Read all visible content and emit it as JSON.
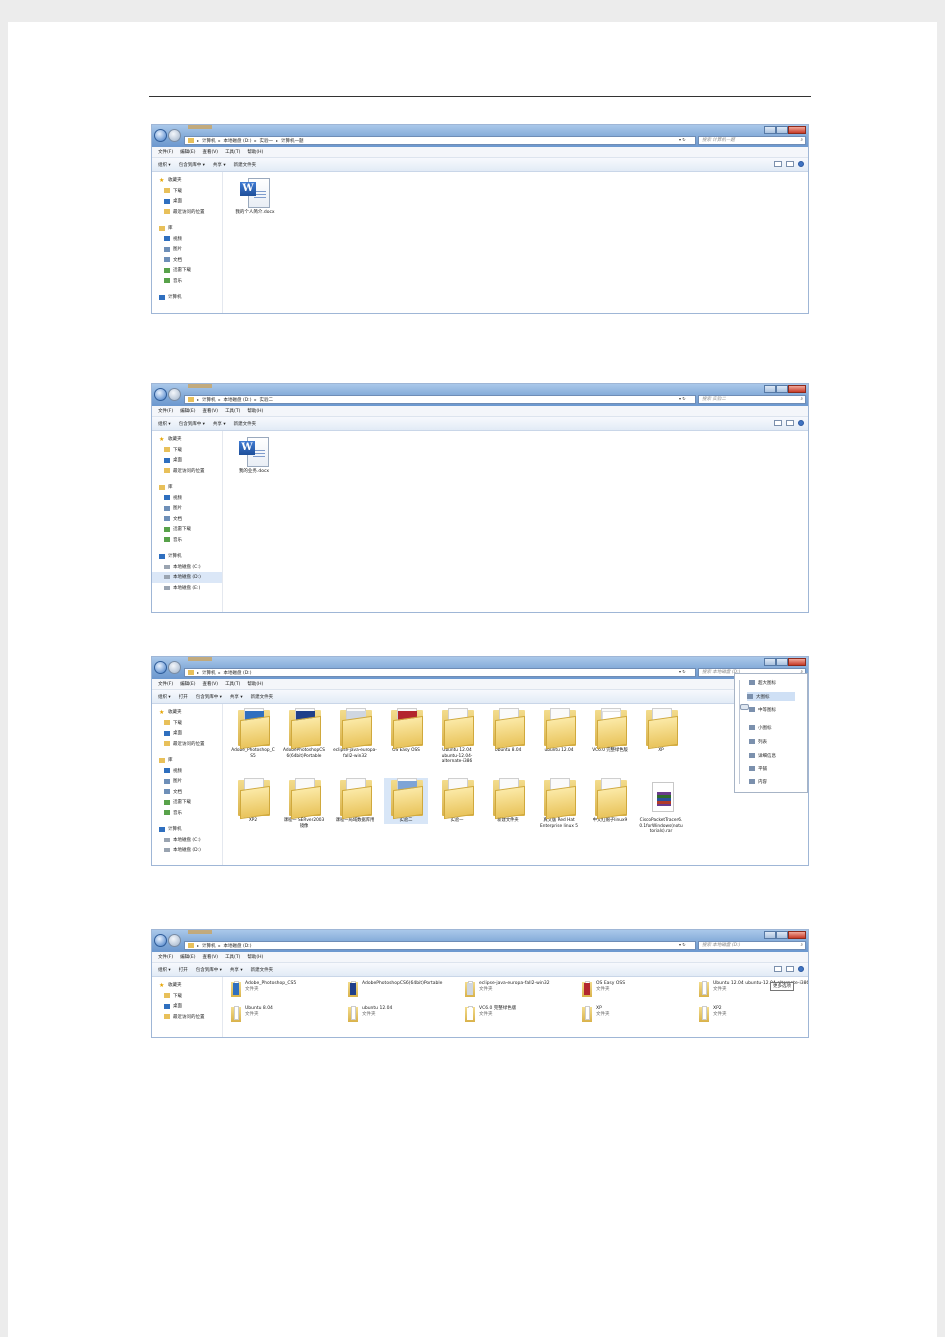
{
  "screenshots": [
    {
      "address": [
        "计算机",
        "本地磁盘 (D:)",
        "实验一",
        "计算机一题"
      ],
      "search_placeholder": "搜索 计算机一题",
      "menu": [
        "文件(F)",
        "编辑(E)",
        "查看(V)",
        "工具(T)",
        "帮助(H)"
      ],
      "toolbar": [
        "组织 ▾",
        "包含到库中 ▾",
        "共享 ▾",
        "新建文件夹"
      ],
      "nav": [
        {
          "label": "收藏夹",
          "icon": "star-icon"
        },
        {
          "label": "下载",
          "icon": "download-icon"
        },
        {
          "label": "桌面",
          "icon": "desktop-icon"
        },
        {
          "label": "最近访问的位置",
          "icon": "recent-places-icon"
        },
        {
          "label": "库",
          "icon": "library-icon"
        },
        {
          "label": "视频",
          "icon": "video-icon"
        },
        {
          "label": "图片",
          "icon": "picture-icon"
        },
        {
          "label": "文档",
          "icon": "document-icon"
        },
        {
          "label": "迅雷下载",
          "icon": "thunder-download-icon"
        },
        {
          "label": "音乐",
          "icon": "music-icon"
        },
        {
          "label": "计算机",
          "icon": "computer-icon"
        }
      ],
      "file": {
        "name": "我的个人简介.docx"
      }
    },
    {
      "address": [
        "计算机",
        "本地磁盘 (D:)",
        "实验二"
      ],
      "search_placeholder": "搜索 实验二",
      "menu": [
        "文件(F)",
        "编辑(E)",
        "查看(V)",
        "工具(T)",
        "帮助(H)"
      ],
      "toolbar": [
        "组织 ▾",
        "包含到库中 ▾",
        "共享 ▾",
        "新建文件夹"
      ],
      "nav": [
        {
          "label": "收藏夹",
          "icon": "star-icon"
        },
        {
          "label": "下载",
          "icon": "download-icon"
        },
        {
          "label": "桌面",
          "icon": "desktop-icon"
        },
        {
          "label": "最近访问的位置",
          "icon": "recent-places-icon"
        },
        {
          "label": "库",
          "icon": "library-icon"
        },
        {
          "label": "视频",
          "icon": "video-icon"
        },
        {
          "label": "图片",
          "icon": "picture-icon"
        },
        {
          "label": "文档",
          "icon": "document-icon"
        },
        {
          "label": "迅雷下载",
          "icon": "thunder-download-icon"
        },
        {
          "label": "音乐",
          "icon": "music-icon"
        },
        {
          "label": "计算机",
          "icon": "computer-icon"
        },
        {
          "label": "本地磁盘 (C:)",
          "icon": "drive-icon"
        },
        {
          "label": "本地磁盘 (D:)",
          "icon": "drive-icon"
        },
        {
          "label": "本地磁盘 (E:)",
          "icon": "drive-icon"
        }
      ],
      "file": {
        "name": "我的业务.docx"
      }
    },
    {
      "address": [
        "计算机",
        "本地磁盘 (D:)"
      ],
      "search_placeholder": "搜索 本地磁盘 (D:)",
      "menu": [
        "文件(F)",
        "编辑(E)",
        "查看(V)",
        "工具(T)",
        "帮助(H)"
      ],
      "toolbar": [
        "组织 ▾",
        "打开",
        "包含到库中 ▾",
        "共享 ▾",
        "新建文件夹"
      ],
      "nav": [
        {
          "label": "收藏夹",
          "icon": "star-icon"
        },
        {
          "label": "下载",
          "icon": "download-icon"
        },
        {
          "label": "桌面",
          "icon": "desktop-icon"
        },
        {
          "label": "最近访问的位置",
          "icon": "recent-places-icon"
        },
        {
          "label": "库",
          "icon": "library-icon"
        },
        {
          "label": "视频",
          "icon": "video-icon"
        },
        {
          "label": "图片",
          "icon": "picture-icon"
        },
        {
          "label": "文档",
          "icon": "document-icon"
        },
        {
          "label": "迅雷下载",
          "icon": "thunder-download-icon"
        },
        {
          "label": "音乐",
          "icon": "music-icon"
        },
        {
          "label": "计算机",
          "icon": "computer-icon"
        },
        {
          "label": "本地磁盘 (C:)",
          "icon": "drive-icon"
        },
        {
          "label": "本地磁盘 (D:)",
          "icon": "drive-icon"
        }
      ],
      "folders": [
        {
          "name": "Adobe_Photoshop_CS5",
          "cover": "#2f6fbf"
        },
        {
          "name": "AdobePhotoshopCS6(64bit)Portable",
          "cover": "#1f3f8a"
        },
        {
          "name": "eclipse-java-europa-fall2-win32",
          "cover": "#cfd6e0"
        },
        {
          "name": "OS Easy OSS",
          "cover": "#b3262e"
        },
        {
          "name": "Ubuntu 12.04 ubuntu-12.04-alternate-i386",
          "cover": ""
        },
        {
          "name": "Ubuntu 8.04",
          "cover": ""
        },
        {
          "name": "ubuntu 12.04",
          "cover": ""
        },
        {
          "name": "VC6.0 完整绿色版",
          "cover": "#ffffff"
        },
        {
          "name": "XP",
          "cover": ""
        },
        {
          "name": "XP2",
          "cover": ""
        },
        {
          "name": "课程一 SERver2003镜像",
          "cover": ""
        },
        {
          "name": "课程一局域数据库用",
          "cover": ""
        },
        {
          "name": "实验二",
          "cover": "#7ea4d6"
        },
        {
          "name": "实验一",
          "cover": ""
        },
        {
          "name": "新建文件夹",
          "cover": ""
        },
        {
          "name": "真文版 Red Hat Enterprise linux 5",
          "cover": ""
        },
        {
          "name": "中文红帽子linux9",
          "cover": ""
        }
      ],
      "rar_file": {
        "name": "CiscoPacketTracer6.0.1forWindows(notutorials).rar"
      },
      "view_menu": [
        "超大图标",
        "大图标",
        "中等图标",
        "小图标",
        "列表",
        "详细信息",
        "平铺",
        "内容"
      ],
      "view_menu_selected": 1
    },
    {
      "address": [
        "计算机",
        "本地磁盘 (D:)"
      ],
      "search_placeholder": "搜索 本地磁盘 (D:)",
      "menu": [
        "文件(F)",
        "编辑(E)",
        "查看(V)",
        "工具(T)",
        "帮助(H)"
      ],
      "toolbar": [
        "组织 ▾",
        "打开",
        "包含到库中 ▾",
        "共享 ▾",
        "新建文件夹"
      ],
      "nav": [
        {
          "label": "收藏夹",
          "icon": "star-icon"
        },
        {
          "label": "下载",
          "icon": "download-icon"
        },
        {
          "label": "桌面",
          "icon": "desktop-icon"
        },
        {
          "label": "最近访问的位置",
          "icon": "recent-places-icon"
        }
      ],
      "tooltip": "更多选项",
      "items": [
        {
          "name": "Adobe_Photoshop_CS5",
          "type": "文件夹",
          "cover": "#2f6fbf"
        },
        {
          "name": "AdobePhotoshopCS6(64bit)Portable",
          "type": "",
          "cover": "#1f3f8a"
        },
        {
          "name": "eclipse-java-europa-fall2-win32",
          "type": "文件夹",
          "cover": "#cfd6e0"
        },
        {
          "name": "OS Easy OSS",
          "type": "文件夹",
          "cover": "#b3262e"
        },
        {
          "name": "Ubuntu 12.04 ubuntu-12.04-alternate-i386",
          "type": "文件夹",
          "cover": ""
        },
        {
          "name": "Ubuntu 8.04",
          "type": "文件夹",
          "cover": ""
        },
        {
          "name": "ubuntu 12.04",
          "type": "文件夹",
          "cover": ""
        },
        {
          "name": "VC6.0 完整绿色版",
          "type": "文件夹",
          "cover": "#ffffff"
        },
        {
          "name": "XP",
          "type": "文件夹",
          "cover": ""
        },
        {
          "name": "XP2",
          "type": "文件夹",
          "cover": ""
        }
      ]
    }
  ]
}
